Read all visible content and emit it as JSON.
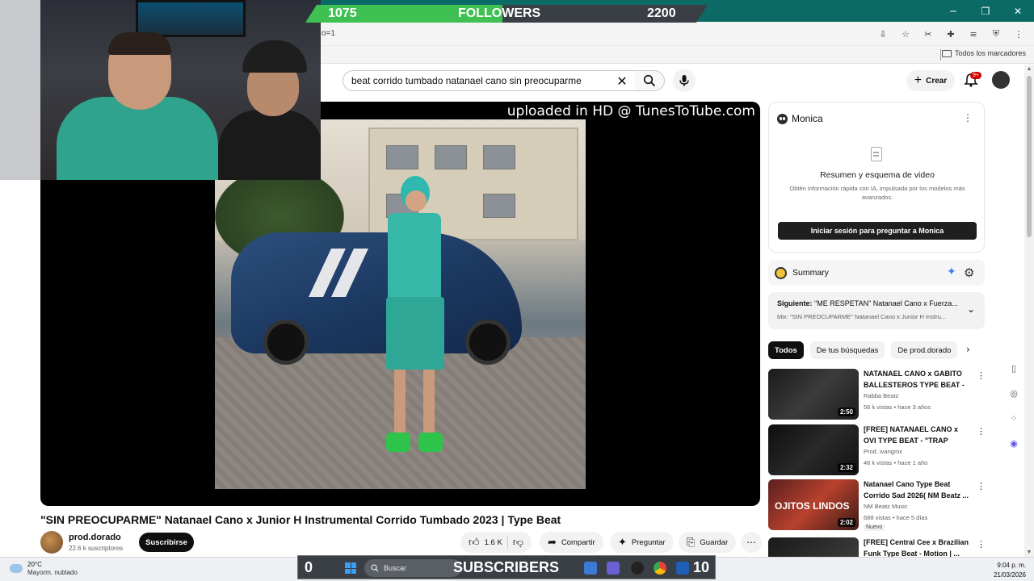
{
  "overlays": {
    "followers": {
      "label": "FOLLOWERS",
      "current": "1075",
      "goal": "2200",
      "progress": 0.49
    },
    "subscribers": {
      "label": "SUBSCRIBERS",
      "current": "0",
      "goal": "10"
    }
  },
  "browser": {
    "url_fragment": "o=1",
    "bookmarks_folder": "Todos los marcadores"
  },
  "youtube": {
    "search_query": "beat corrido tumbado natanael cano sin preocuparme",
    "create_label": "Crear",
    "notifications_badge": "9+",
    "player_overlay_text": "uploaded in HD @ TunesToTube.com",
    "video_title": "\"SIN PREOCUPARME\" Natanael Cano x Junior H Instrumental Corrido Tumbado 2023 | Type Beat",
    "channel": {
      "name": "prod.dorado",
      "subscribers": "22.6 k suscriptores",
      "subscribe_label": "Suscribirse"
    },
    "actions": {
      "likes": "1.6 K",
      "share": "Compartir",
      "ask": "Preguntar",
      "save": "Guardar"
    }
  },
  "monica": {
    "name": "Monica",
    "title": "Resumen y esquema de video",
    "description": "Obtén información rápida con IA, impulsada por los modelos más avanzados.",
    "login_button": "Iniciar sesión para preguntar a Monica",
    "summary_label": "Summary"
  },
  "up_next": {
    "label": "Siguiente:",
    "title": "\"ME RESPETAN\" Natanael Cano x Fuerza...",
    "mix": "Mix: \"SIN PREOCUPARME\" Natanael Cano x Junior H Instru..."
  },
  "chips": [
    {
      "label": "Todos"
    },
    {
      "label": "De tus búsquedas"
    },
    {
      "label": "De prod.dorado"
    }
  ],
  "recommendations": [
    {
      "title": "NATANAEL CANO x GABITO BALLESTEROS TYPE BEAT - ...",
      "channel": "Rabba Beatz",
      "meta": "56 k vistas • hace 3 años",
      "duration": "2:50",
      "badge": ""
    },
    {
      "title": "[FREE] NATANAEL CANO x OVI TYPE BEAT - \"TRAP TUMBAD...",
      "channel": "Prod. ivangmx",
      "meta": "46 k vistas • hace 1 año",
      "duration": "2:32",
      "badge": ""
    },
    {
      "title": "Natanael Cano Type Beat Corrido Sad 2026( NM Beatz ...",
      "channel": "NM Beatz Music",
      "meta": "688 vistas • hace 5 días",
      "duration": "2:02",
      "badge": "Nuevo",
      "thumb_text": "OJITOS LINDOS"
    },
    {
      "title": "[FREE] Central Cee x Brazilian Funk Type Beat - Motion | ...",
      "channel": "",
      "meta": "",
      "duration": "",
      "badge": ""
    }
  ],
  "taskbar": {
    "weather_temp": "20°C",
    "weather_condition": "Mayorm. nublado",
    "search_placeholder": "Buscar",
    "time": "9:04 p. m.",
    "date": "21/03/2026"
  },
  "colors": {
    "followers_fill": "#3ec152",
    "tabbar": "#0b6a66",
    "accent_red": "#cc0000"
  }
}
